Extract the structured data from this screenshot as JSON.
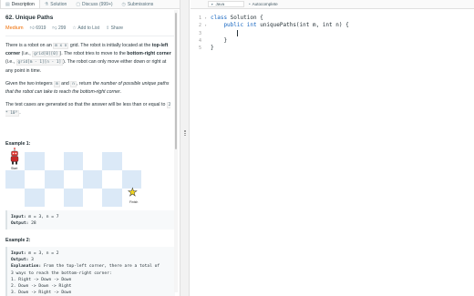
{
  "tabs": [
    {
      "icon": "document-icon",
      "label": "Description"
    },
    {
      "icon": "flask-icon",
      "label": "Solution"
    },
    {
      "icon": "chat-icon",
      "label": "Discuss (999+)"
    },
    {
      "icon": "history-icon",
      "label": "Submissions"
    }
  ],
  "problem": {
    "title": "62. Unique Paths",
    "difficulty": "Medium",
    "difficulty_color": "#ef6c00",
    "likes": "6919",
    "dislikes": "299",
    "add_to_list": "Add to List",
    "share": "Share"
  },
  "description": {
    "p1_a": "There is a robot on an ",
    "p1_code1": "m x n",
    "p1_b": " grid. The robot is initially located at the ",
    "p1_bold1": "top-left corner",
    "p1_c": " (i.e., ",
    "p1_code2": "grid[0][0]",
    "p1_d": "). The robot tries to move to the ",
    "p1_bold2": "bottom-right corner",
    "p1_e": " (i.e., ",
    "p1_code3": "grid[m - 1][n - 1]",
    "p1_f": "). The robot can only move either down or right at any point in time.",
    "p2_a": "Given the two integers ",
    "p2_code1": "m",
    "p2_b": " and ",
    "p2_code2": "n",
    "p2_c": ", return ",
    "p2_italic": "the number of possible unique paths that the robot can take to reach the bottom-right corner",
    "p2_d": ".",
    "p3_a": "The test cases are generated so that the answer will be less than or equal to ",
    "p3_code": "2 * 10⁹",
    "p3_b": "."
  },
  "example1": {
    "label": "Example 1:",
    "start_label": "Start",
    "finish_label": "Finish",
    "input_key": "Input:",
    "input_val": " m = 3, n = 7",
    "output_key": "Output:",
    "output_val": " 28"
  },
  "example2": {
    "label": "Example 2:",
    "input_key": "Input:",
    "input_val": " m = 3, n = 2",
    "output_key": "Output:",
    "output_val": " 3",
    "explanation_key": "Explanation:",
    "explanation_val": " From the top-left corner, there are a total of",
    "explanation_line2": "3 ways to reach the bottom-right corner:",
    "path1": "1. Right -> Down -> Down",
    "path2": "2. Down -> Down -> Right",
    "path3": "3. Down -> Right -> Down"
  },
  "editor": {
    "language": "Java",
    "autocomplete_label": "Autocomplete",
    "lines": [
      {
        "num": "1",
        "fold": "▾",
        "kw": "class",
        "rest": " Solution {"
      },
      {
        "num": "2",
        "fold": "▾",
        "kw": "    public int",
        "rest": " uniquePaths(int m, int n) {"
      },
      {
        "num": "3",
        "fold": "",
        "kw": "",
        "rest": "        "
      },
      {
        "num": "4",
        "fold": "",
        "kw": "",
        "rest": "    }"
      },
      {
        "num": "5",
        "fold": "",
        "kw": "",
        "rest": "}"
      }
    ]
  }
}
